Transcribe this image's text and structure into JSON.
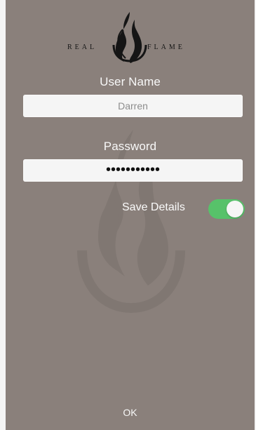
{
  "logo": {
    "left_word": "REAL",
    "right_word": "FLAME"
  },
  "form": {
    "username_label": "User Name",
    "username_value": "Darren",
    "password_label": "Password",
    "password_value": "•••••••••••",
    "save_details_label": "Save Details",
    "save_details_enabled": true
  },
  "actions": {
    "ok_label": "OK"
  },
  "colors": {
    "background": "#8a807b",
    "field": "#f5f5f5",
    "toggle_on": "#57c26a"
  }
}
